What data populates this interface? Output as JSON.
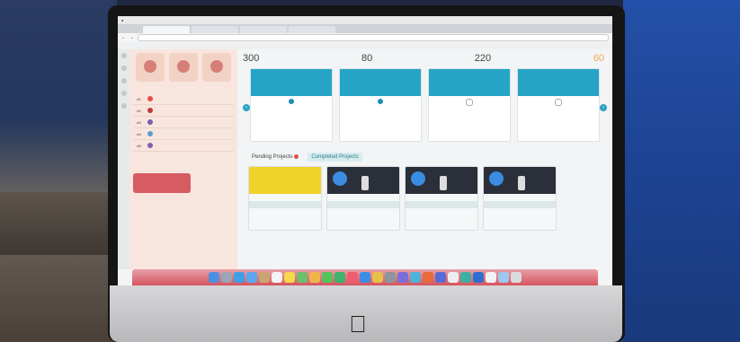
{
  "browser": {
    "tabs": [
      "",
      "",
      "",
      ""
    ],
    "url": ""
  },
  "stats": [
    {
      "value": "300",
      "label": ""
    },
    {
      "value": "80",
      "label": ""
    },
    {
      "value": "220",
      "label": ""
    },
    {
      "value": "60",
      "label": ""
    }
  ],
  "leaderboard": {
    "ranks": [
      "#1",
      "#2",
      "#3",
      "#4",
      "#5"
    ]
  },
  "sections": {
    "pending": "Pending Projects",
    "completed": "Completed Projects"
  },
  "colors": {
    "accent": "#25a4c6",
    "left_panel": "#f8e6de",
    "dock": "#d6545f",
    "stat_orange": "#f0a95b"
  }
}
